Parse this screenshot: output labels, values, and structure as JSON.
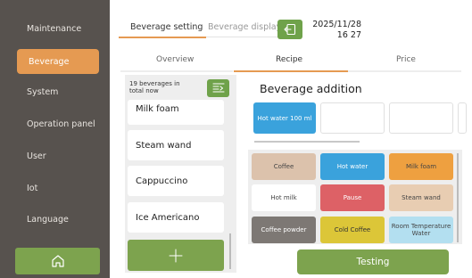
{
  "sidebar": {
    "items": [
      {
        "label": "Maintenance",
        "active": false
      },
      {
        "label": "Beverage",
        "active": true
      },
      {
        "label": "System",
        "active": false
      },
      {
        "label": "Operation panel",
        "active": false
      },
      {
        "label": "User",
        "active": false
      },
      {
        "label": "Iot",
        "active": false
      },
      {
        "label": "Language",
        "active": false
      }
    ],
    "home_icon": "home-icon"
  },
  "header": {
    "tabs": [
      {
        "label": "Beverage setting",
        "active": true
      },
      {
        "label": "Beverage display",
        "active": false
      }
    ],
    "back_icon": "exit-icon",
    "date": "2025/11/28",
    "time": "16 27"
  },
  "subtabs": [
    {
      "label": "Overview",
      "active": false
    },
    {
      "label": "Recipe",
      "active": true
    },
    {
      "label": "Price",
      "active": false
    }
  ],
  "beverage_list": {
    "count_text": "19 beverages in total now",
    "sort_icon": "sort-icon",
    "items": [
      "Milk foam",
      "Steam wand",
      "Cappuccino",
      "Ice Americano"
    ],
    "add_icon": "plus-icon"
  },
  "addition": {
    "title": "Beverage addition",
    "slots": [
      {
        "label": "Hot water 100 ml",
        "color": "#3aa2dc"
      },
      {
        "label": "",
        "color": "#ffffff"
      },
      {
        "label": "",
        "color": "#ffffff"
      },
      {
        "label": "",
        "color": "#ffffff"
      }
    ]
  },
  "ingredients": [
    {
      "label": "Coffee",
      "color": "#dcc2ac"
    },
    {
      "label": "Hot water",
      "color": "#3aa2dc"
    },
    {
      "label": "Milk foam",
      "color": "#eea040"
    },
    {
      "label": "Hot milk",
      "color": "#ffffff"
    },
    {
      "label": "Pause",
      "color": "#dd6166"
    },
    {
      "label": "Steam wand",
      "color": "#e8cdb2"
    },
    {
      "label": "Coffee powder",
      "color": "#7d7874"
    },
    {
      "label": "Cold Coffee",
      "color": "#dcc638"
    },
    {
      "label": "Room Temperature Water",
      "color": "#b3dff0"
    }
  ],
  "actions": {
    "testing_label": "Testing"
  }
}
